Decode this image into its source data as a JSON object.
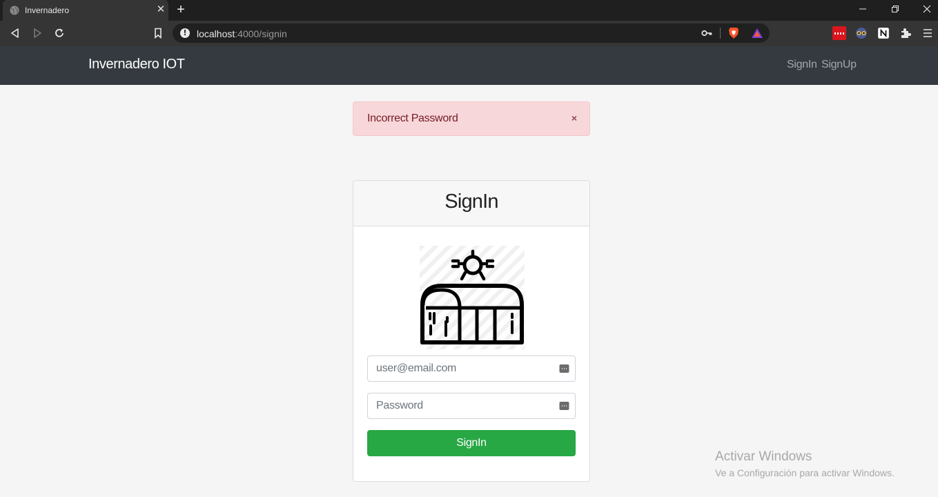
{
  "browser": {
    "tab_title": "Invernadero",
    "url_host": "localhost",
    "url_rest": ":4000/signin"
  },
  "navbar": {
    "brand": "Invernadero IOT",
    "links": [
      "SignIn",
      "SignUp"
    ]
  },
  "alert": {
    "message": "Incorrect Password",
    "close": "×"
  },
  "form": {
    "title": "SignIn",
    "email_placeholder": "user@email.com",
    "password_placeholder": "Password",
    "submit_label": "SignIn",
    "submit_color": "#28a745"
  },
  "watermark": {
    "line1": "Activar Windows",
    "line2": "Ve a Configuración para activar Windows."
  }
}
